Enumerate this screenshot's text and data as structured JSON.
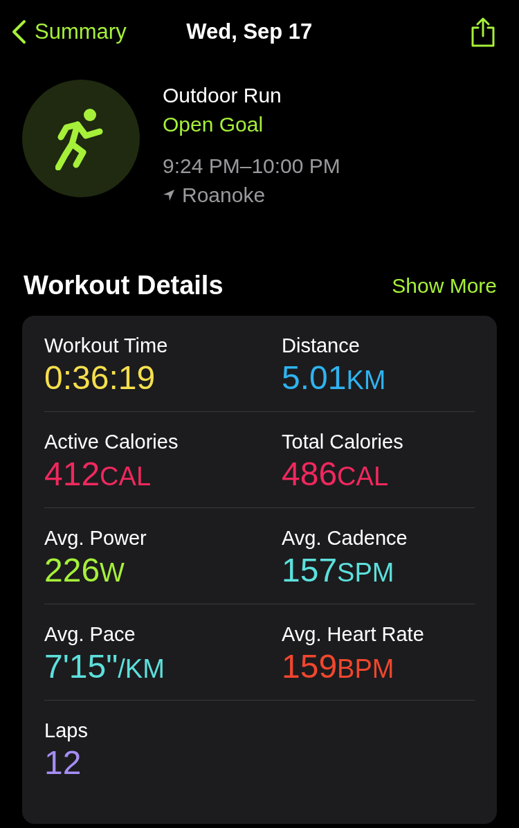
{
  "nav": {
    "back_label": "Summary",
    "title": "Wed, Sep 17"
  },
  "workout": {
    "type": "Outdoor Run",
    "goal": "Open Goal",
    "time_range": "9:24 PM–10:00 PM",
    "location": "Roanoke"
  },
  "section": {
    "title": "Workout Details",
    "action": "Show More"
  },
  "metrics": [
    {
      "label": "Workout Time",
      "value": "0:36:19",
      "color": "#f5df4d"
    },
    {
      "label": "Distance",
      "value": "5.01",
      "unit": "KM",
      "color": "#2fb3f0"
    },
    {
      "label": "Active Calories",
      "value": "412",
      "unit": "CAL",
      "color": "#f0285e"
    },
    {
      "label": "Total Calories",
      "value": "486",
      "unit": "CAL",
      "color": "#f0285e"
    },
    {
      "label": "Avg. Power",
      "value": "226",
      "unit": "W",
      "color": "#a6f03a"
    },
    {
      "label": "Avg. Cadence",
      "value": "157",
      "unit": "SPM",
      "color": "#5de0dc"
    },
    {
      "label": "Avg. Pace",
      "value": "7'15\"",
      "unit": "/KM",
      "color": "#5de0dc"
    },
    {
      "label": "Avg. Heart Rate",
      "value": "159",
      "unit": "BPM",
      "color": "#f0472e"
    },
    {
      "label": "Laps",
      "value": "12",
      "color": "#a58df2"
    }
  ]
}
